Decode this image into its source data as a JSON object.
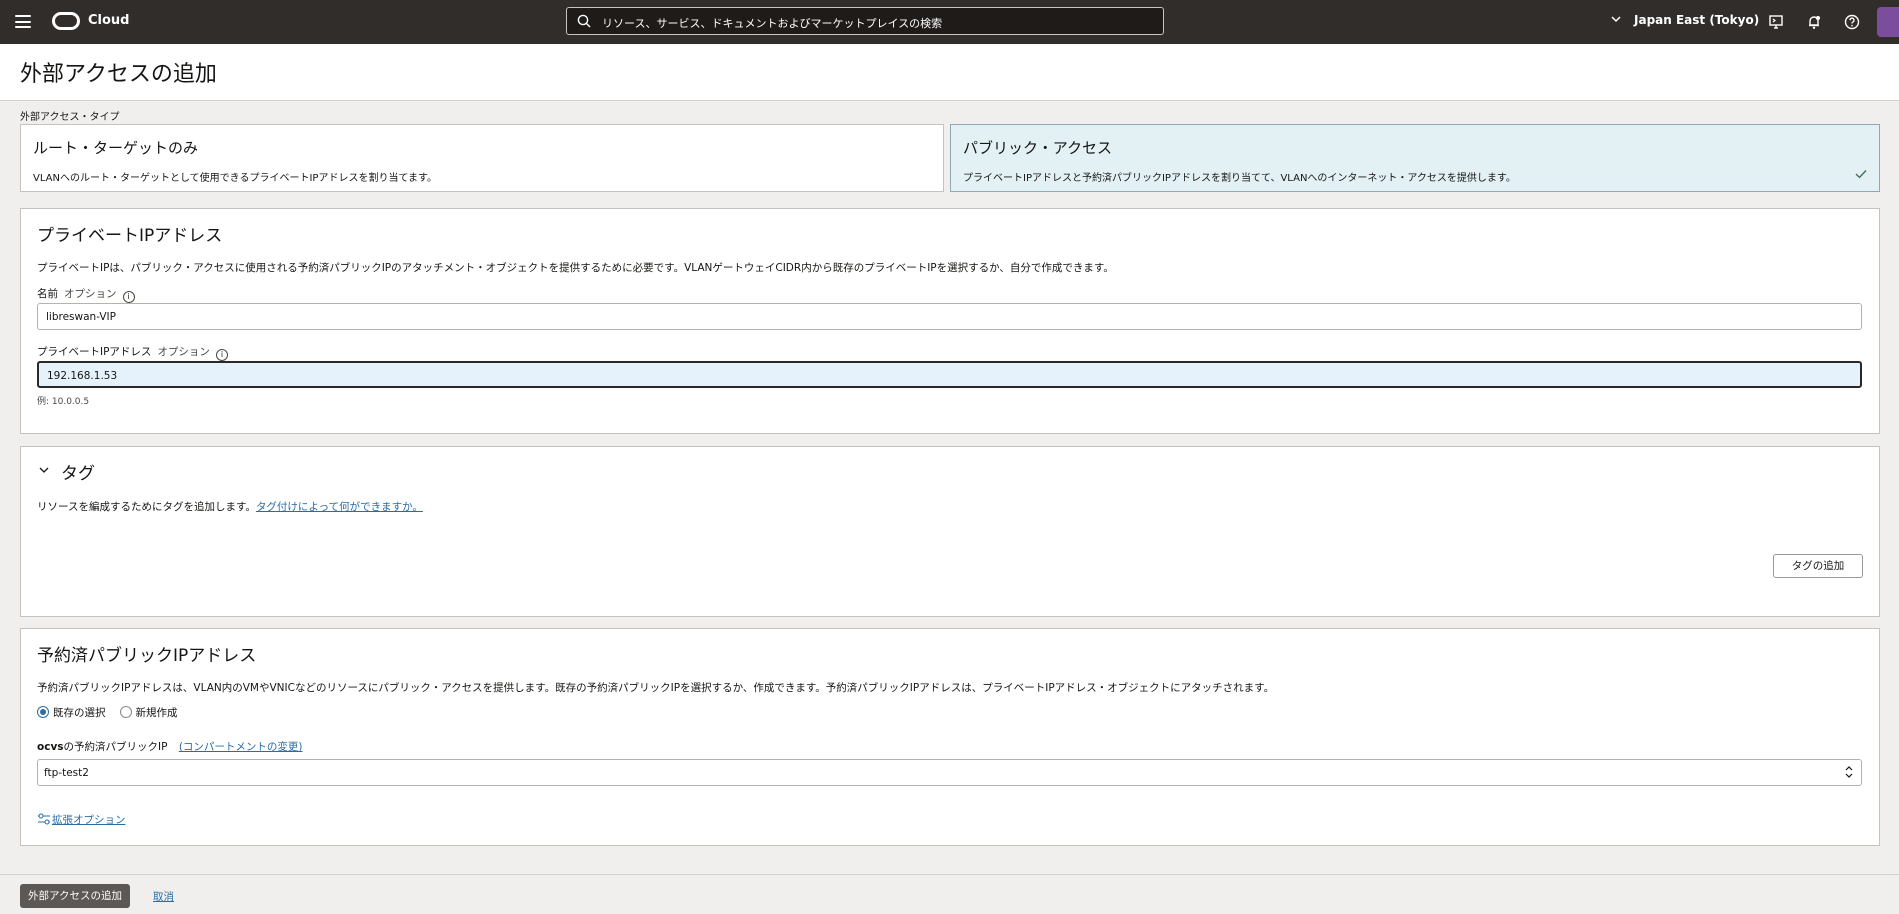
{
  "topbar": {
    "brand": "Cloud",
    "search_placeholder": "リソース、サービス、ドキュメントおよびマーケットプレイスの検索",
    "region": "Japan East (Tokyo)"
  },
  "page": {
    "title": "外部アクセスの追加",
    "access_type_label": "外部アクセス・タイプ"
  },
  "access_types": [
    {
      "title": "ルート・ターゲットのみ",
      "desc": "VLANへのルート・ターゲットとして使用できるプライベートIPアドレスを割り当てます。"
    },
    {
      "title": "パブリック・アクセス",
      "desc": "プライベートIPアドレスと予約済パブリックIPアドレスを割り当てて、VLANへのインターネット・アクセスを提供します。"
    }
  ],
  "private_ip": {
    "title": "プライベートIPアドレス",
    "desc": "プライベートIPは、パブリック・アクセスに使用される予約済パブリックIPのアタッチメント・オブジェクトを提供するために必要です。VLANゲートウェイCIDR内から既存のプライベートIPを選択するか、自分で作成できます。",
    "name_label": "名前",
    "optional": "オプション",
    "name_value": "libreswan-VIP",
    "ip_label": "プライベートIPアドレス",
    "ip_value": "192.168.1.53",
    "ip_hint": "例: 10.0.0.5",
    "info_glyph": "i"
  },
  "tags": {
    "title": "タグ",
    "desc": "リソースを編成するためにタグを追加します。",
    "link": "タグ付けによって何ができますか。",
    "add_button": "タグの追加"
  },
  "reserved_ip": {
    "title": "予約済パブリックIPアドレス",
    "desc": "予約済パブリックIPアドレスは、VLAN内のVMやVNICなどのリソースにパブリック・アクセスを提供します。既存の予約済パブリックIPを選択するか、作成できます。予約済パブリックIPアドレスは、プライベートIPアドレス・オブジェクトにアタッチされます。",
    "radio_existing": "既存の選択",
    "radio_new": "新規作成",
    "select_label_bold": "ocvs",
    "select_label_rest": "の予約済パブリックIP",
    "change_compartment": "(コンパートメントの変更)",
    "select_value": "ftp-test2",
    "advanced_options": "拡張オプション"
  },
  "footer": {
    "submit": "外部アクセスの追加",
    "cancel": "取消"
  }
}
